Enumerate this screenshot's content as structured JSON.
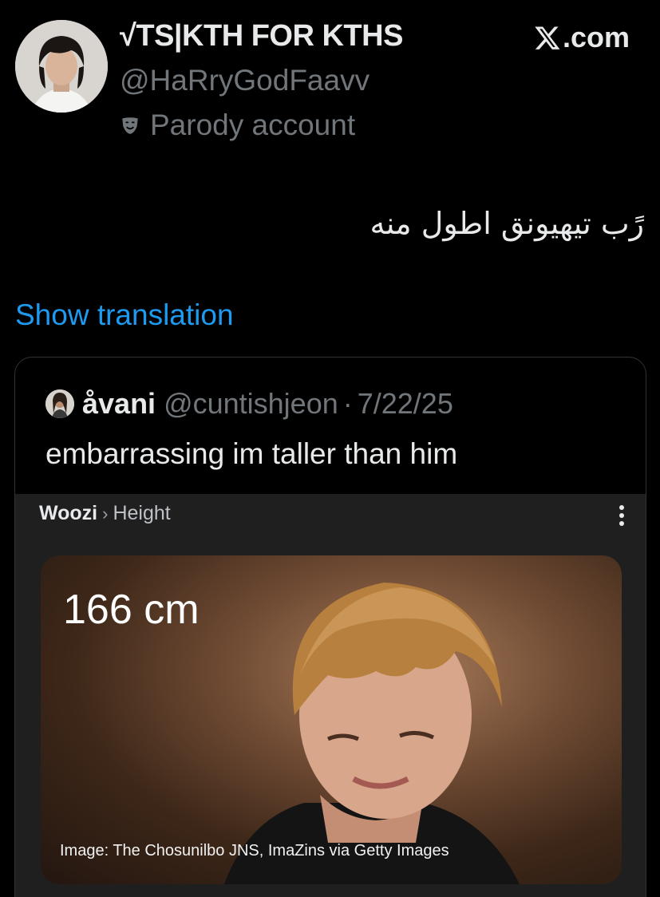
{
  "tweet": {
    "display_name": "√TS|KTH FOR KTHS",
    "handle": "@HaRryGodFaavv",
    "parody_label": "Parody account",
    "text": "رًب تيهيونق اطول منه",
    "show_translation": "Show translation"
  },
  "branding": {
    "logo_text": ".com",
    "icon": "x-logo-icon"
  },
  "quote": {
    "name": "åvani",
    "handle": "@cuntishjeon",
    "separator": "·",
    "date": "7/22/25",
    "text": "embarrassing im taller than him"
  },
  "google_panel": {
    "breadcrumb_primary": "Woozi",
    "breadcrumb_separator": "›",
    "breadcrumb_secondary": "Height",
    "height_value": "166 cm",
    "image_caption": "Image: The Chosunilbo JNS, ImaZins via Getty Images"
  },
  "colors": {
    "background": "#000000",
    "text_primary": "#e7e9ea",
    "text_secondary": "#71767b",
    "link": "#1d9bf0",
    "card_border": "#2f3336",
    "panel_bg": "#1f1f1f"
  }
}
